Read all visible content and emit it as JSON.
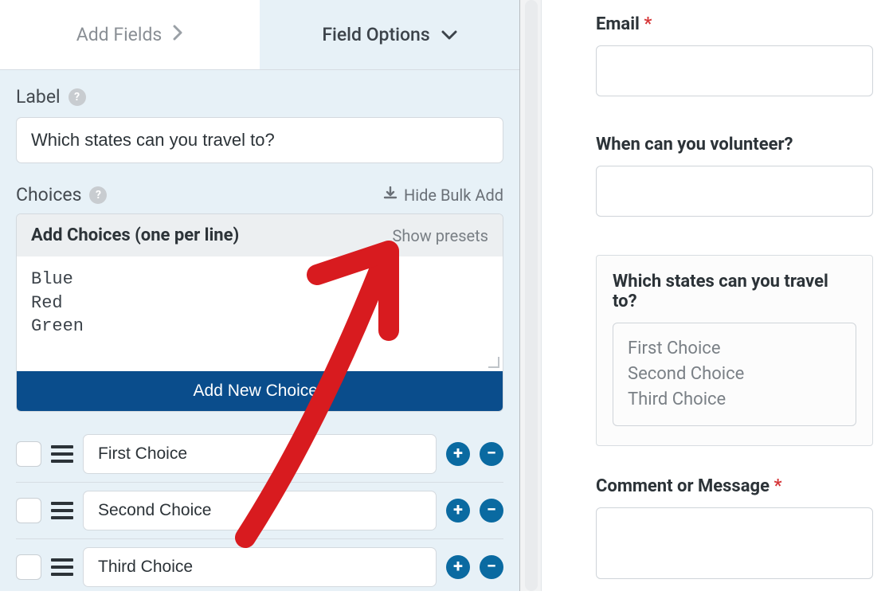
{
  "tabs": {
    "add_fields": "Add Fields",
    "field_options": "Field Options"
  },
  "label_section": {
    "title": "Label",
    "value": "Which states can you travel to?"
  },
  "choices_section": {
    "title": "Choices",
    "hide_bulk": "Hide Bulk Add",
    "bulk_title": "Add Choices (one per line)",
    "show_presets": "Show presets",
    "bulk_value": "Blue\nRed\nGreen",
    "add_button": "Add New Choices",
    "items": [
      {
        "value": "First Choice"
      },
      {
        "value": "Second Choice"
      },
      {
        "value": "Third Choice"
      }
    ]
  },
  "preview": {
    "email_label": "Email",
    "volunteer_label": "When can you volunteer?",
    "states_label": "Which states can you travel to?",
    "choices": [
      "First Choice",
      "Second Choice",
      "Third Choice"
    ],
    "comment_label": "Comment or Message"
  },
  "colors": {
    "accent": "#0a4d8c",
    "circle": "#0a6aa1",
    "required": "#d63638",
    "arrow": "#d81b1f"
  }
}
